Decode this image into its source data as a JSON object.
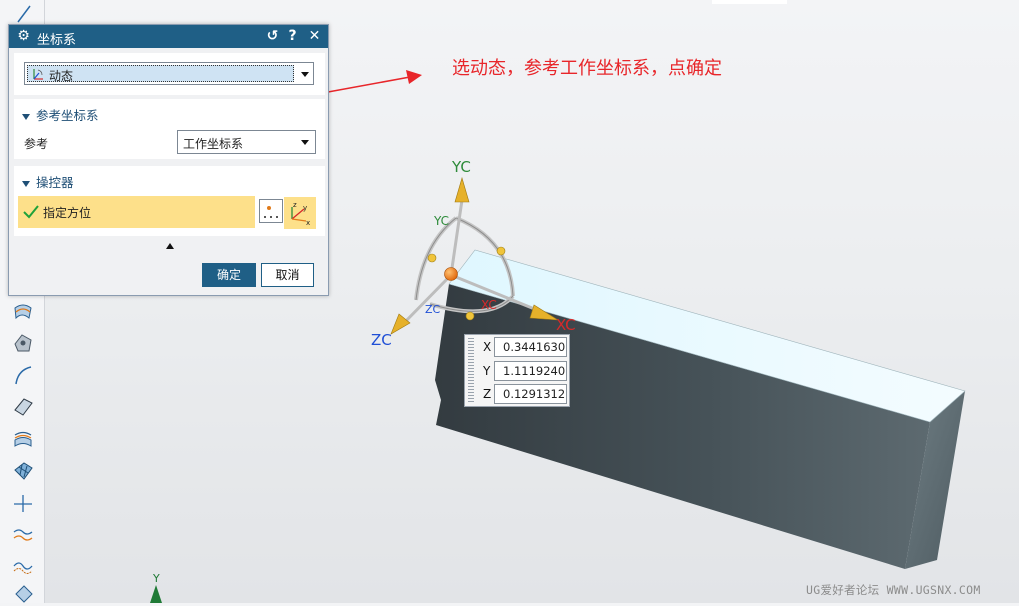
{
  "dialog": {
    "title": "坐标系",
    "type_combo": {
      "value": "动态"
    },
    "reference_section": {
      "header": "参考坐标系",
      "reference_label": "参考",
      "reference_value": "工作坐标系"
    },
    "manipulator_section": {
      "header": "操控器",
      "specify_orientation_label": "指定方位"
    },
    "ok_label": "确定",
    "cancel_label": "取消"
  },
  "annotation": {
    "text": "选动态，参考工作坐标系，点确定",
    "color": "#e8262a"
  },
  "manipulator": {
    "yc_label": "YC",
    "yc_inner_label": "YC",
    "xc_label": "XC",
    "xc_inner_label": "XC",
    "zc_label": "ZC",
    "zc_inner_label": "ZC"
  },
  "coordinates": {
    "x_label": "X",
    "x_value": "0.3441630",
    "y_label": "Y",
    "y_value": "1.1119240",
    "z_label": "Z",
    "z_value": "0.1291312"
  },
  "triad_bottom_label": "Y",
  "watermark": "UG爱好者论坛 WWW.UGSNX.COM",
  "colors": {
    "titlebar": "#1f5f86",
    "selected_row": "#fde08a",
    "yc_axis": "#2e8b3a",
    "xc_axis": "#d62a2a",
    "zc_axis": "#1f4fd6",
    "part_body": "#3f4a50",
    "part_top": "#eafaff"
  },
  "icons": [
    "settings-gear-icon",
    "reset-icon",
    "help-icon",
    "close-icon",
    "dynamic-csys-icon",
    "point-dialog-icon",
    "csys-orientation-icon",
    "collapse-arrow-icon"
  ]
}
